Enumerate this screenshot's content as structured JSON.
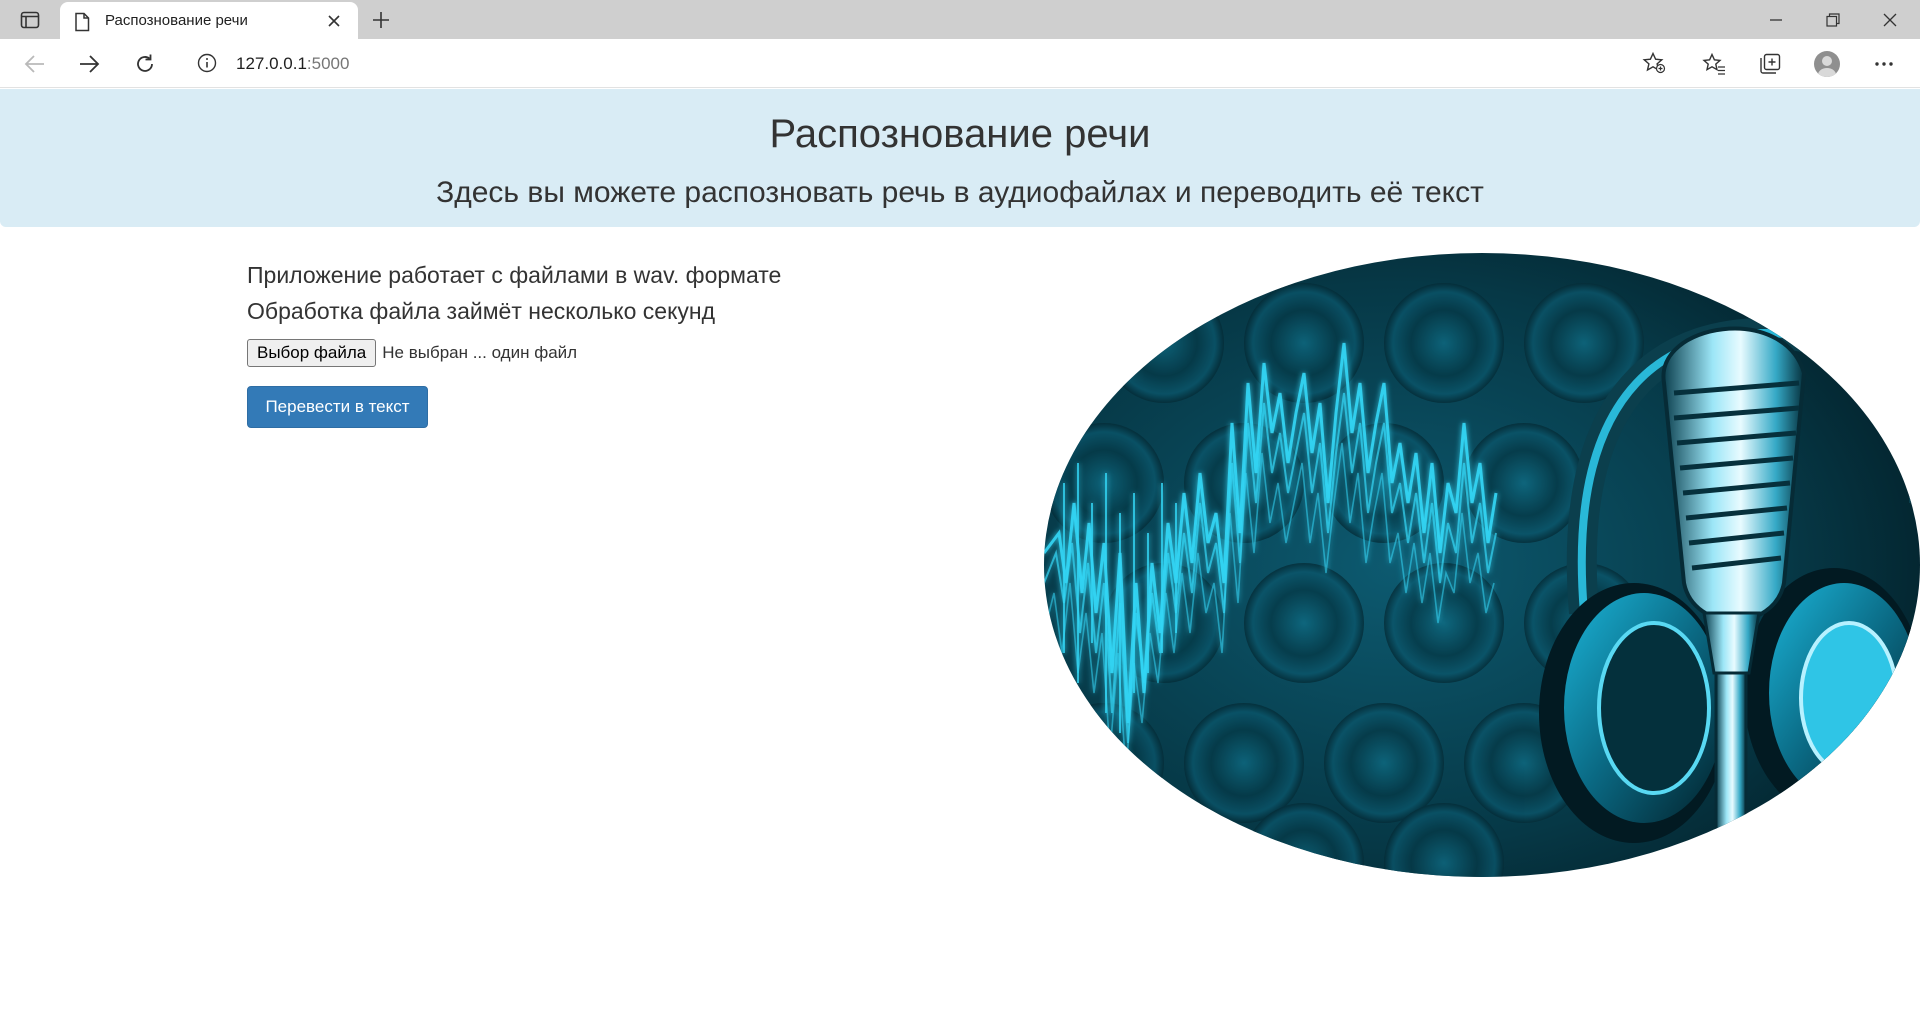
{
  "browser": {
    "tab_title": "Распознование речи",
    "url_host": "127.0.0.1",
    "url_port": ":5000"
  },
  "page": {
    "title": "Распознование речи",
    "subtitle": "Здесь вы можете распозновать речь в аудиофайлах и переводить её текст",
    "info_line1": "Приложение работает с файлами в wav. формате",
    "info_line2": "Обработка файла займёт несколько секунд",
    "file_button": "Выбор файла",
    "file_status": "Не выбран ... один файл",
    "submit_label": "Перевести в текст"
  },
  "icons": {
    "tab_actions": "tab-actions-icon",
    "favicon": "page-icon",
    "close": "close-icon",
    "new_tab": "plus-icon",
    "back": "back-arrow-icon",
    "forward": "forward-arrow-icon",
    "refresh": "refresh-icon",
    "info": "info-icon",
    "favorite": "star-add-icon",
    "favorites": "favorites-icon",
    "collections": "collections-icon",
    "profile": "profile-icon",
    "more": "more-icon"
  },
  "colors": {
    "jumbotron": "#d9ecf5",
    "primary_button": "#337ab7",
    "tabbar": "#cfcfcf"
  }
}
